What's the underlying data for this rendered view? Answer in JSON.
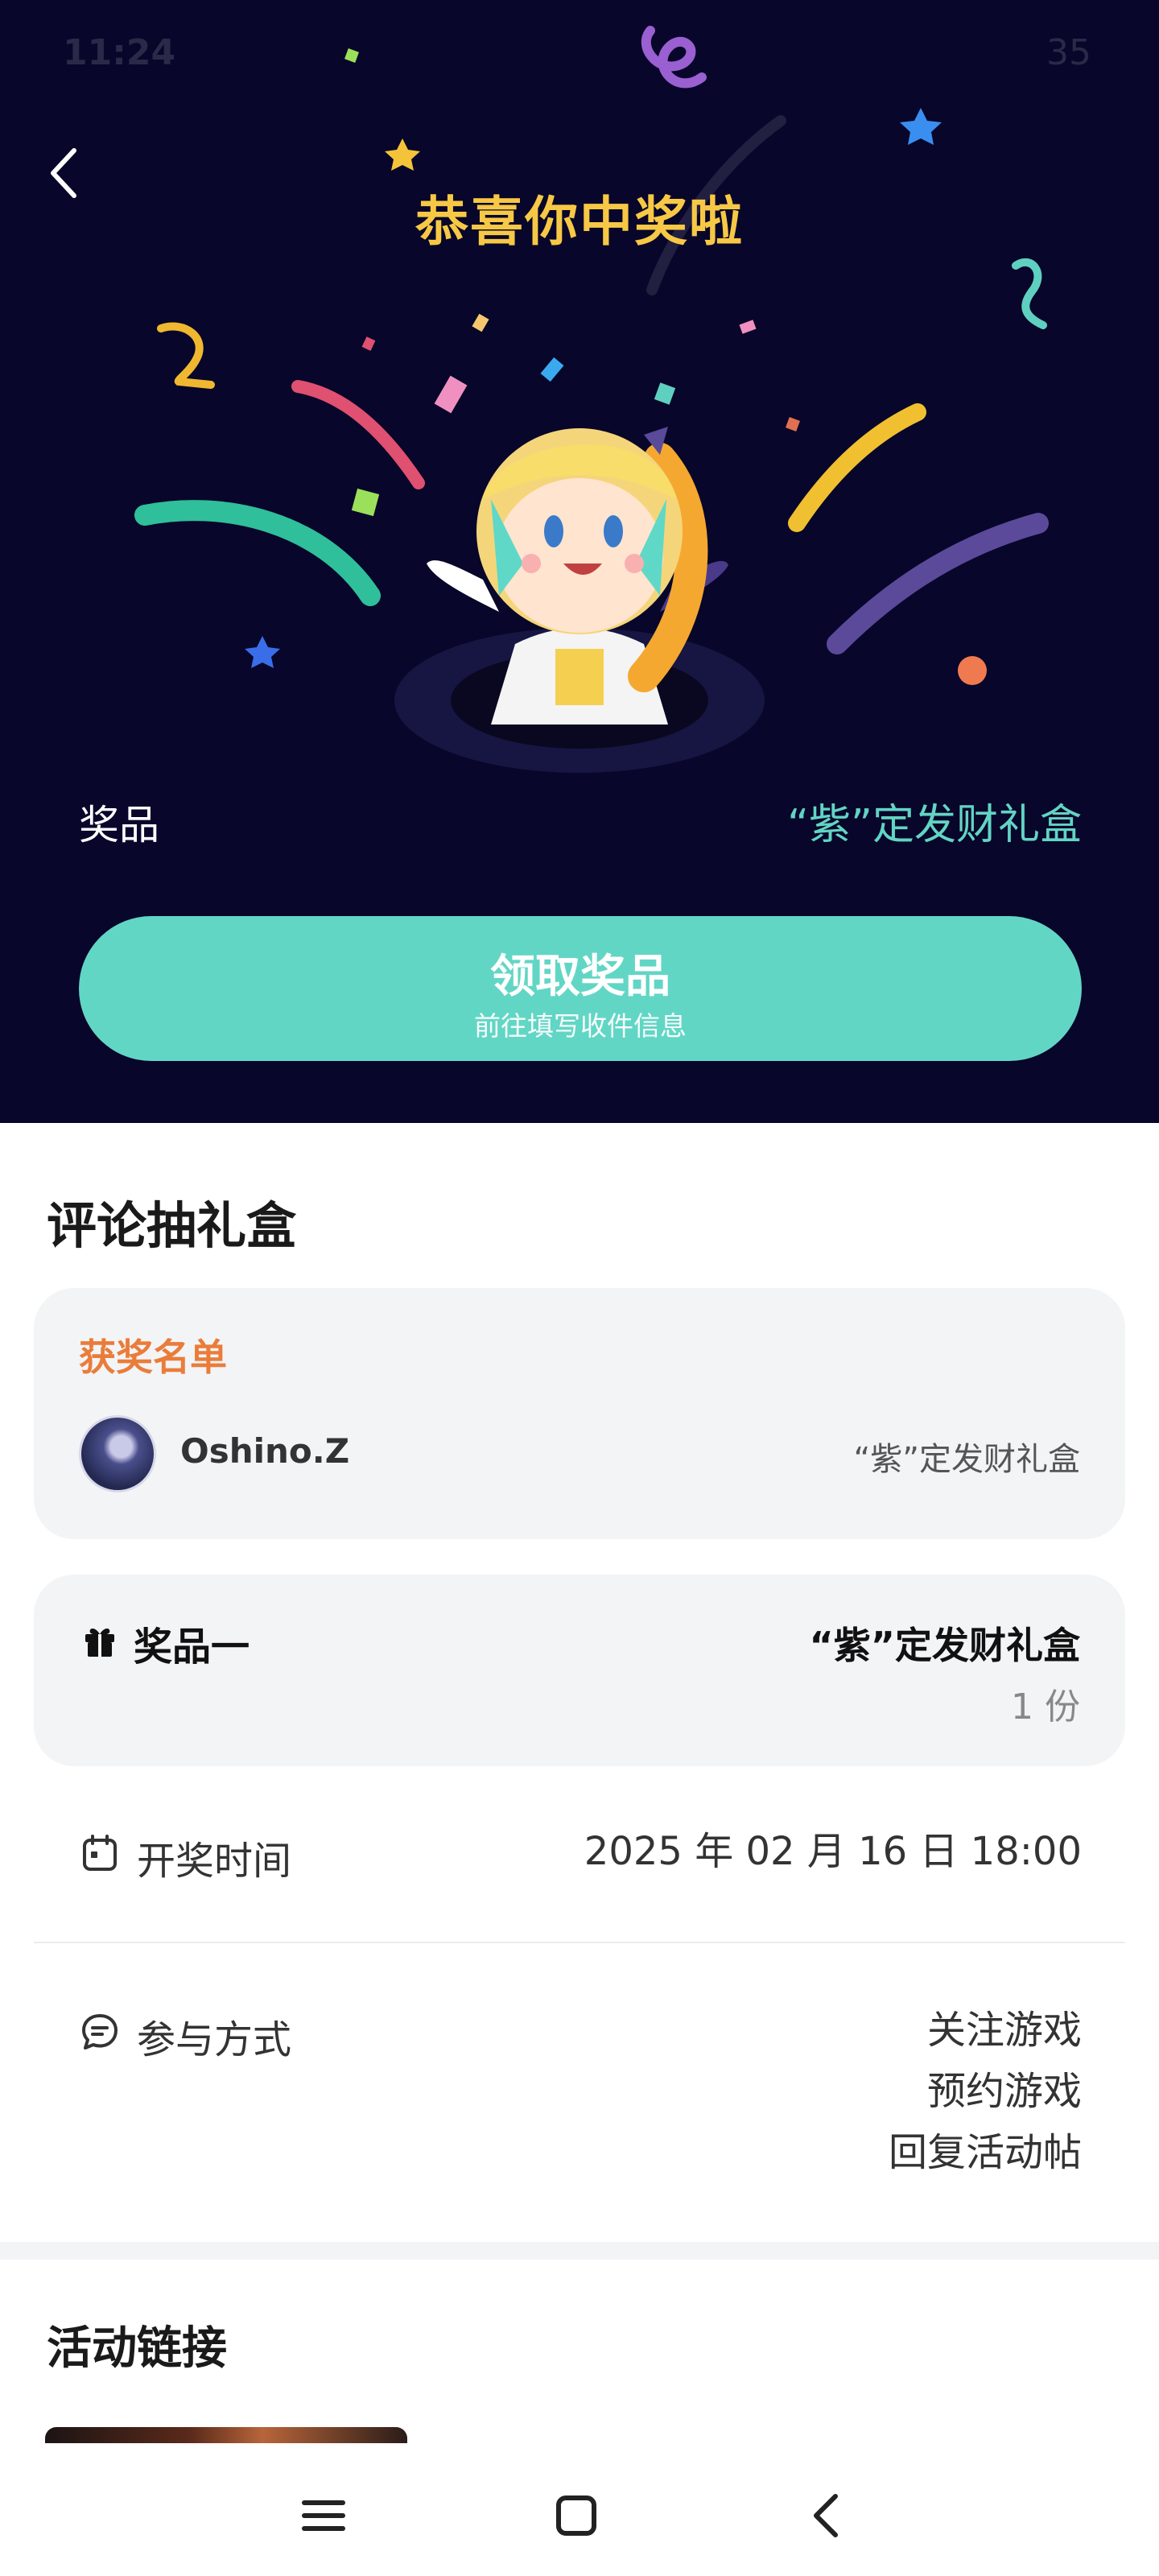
{
  "status_bar": {
    "time": "11:24",
    "battery": "35"
  },
  "hero": {
    "title": "恭喜你中奖啦",
    "prize_label": "奖品",
    "prize_name": "“紫”定发财礼盒",
    "claim_button": {
      "title": "领取奖品",
      "subtitle": "前往填写收件信息"
    }
  },
  "section_title": "评论抽礼盒",
  "winners": {
    "title": "获奖名单",
    "items": [
      {
        "name": "Oshino.Z",
        "prize": "“紫”定发财礼盒"
      }
    ]
  },
  "prize_card": {
    "label": "奖品一",
    "name": "“紫”定发财礼盒",
    "quantity": "1 份"
  },
  "draw_time": {
    "label": "开奖时间",
    "value": "2025 年 02 月 16 日 18:00"
  },
  "participation": {
    "label": "参与方式",
    "methods": [
      "关注游戏",
      "预约游戏",
      "回复活动帖"
    ]
  },
  "activity_links": {
    "title": "活动链接"
  },
  "colors": {
    "hero_bg": "#08062a",
    "accent_teal": "#62d6c5",
    "title_gold": "#f7c845",
    "winners_orange": "#ea7c3a"
  },
  "icons": [
    "back-arrow-icon",
    "gift-icon",
    "calendar-icon",
    "comment-icon",
    "menu-icon",
    "home-square-icon",
    "nav-back-icon"
  ]
}
